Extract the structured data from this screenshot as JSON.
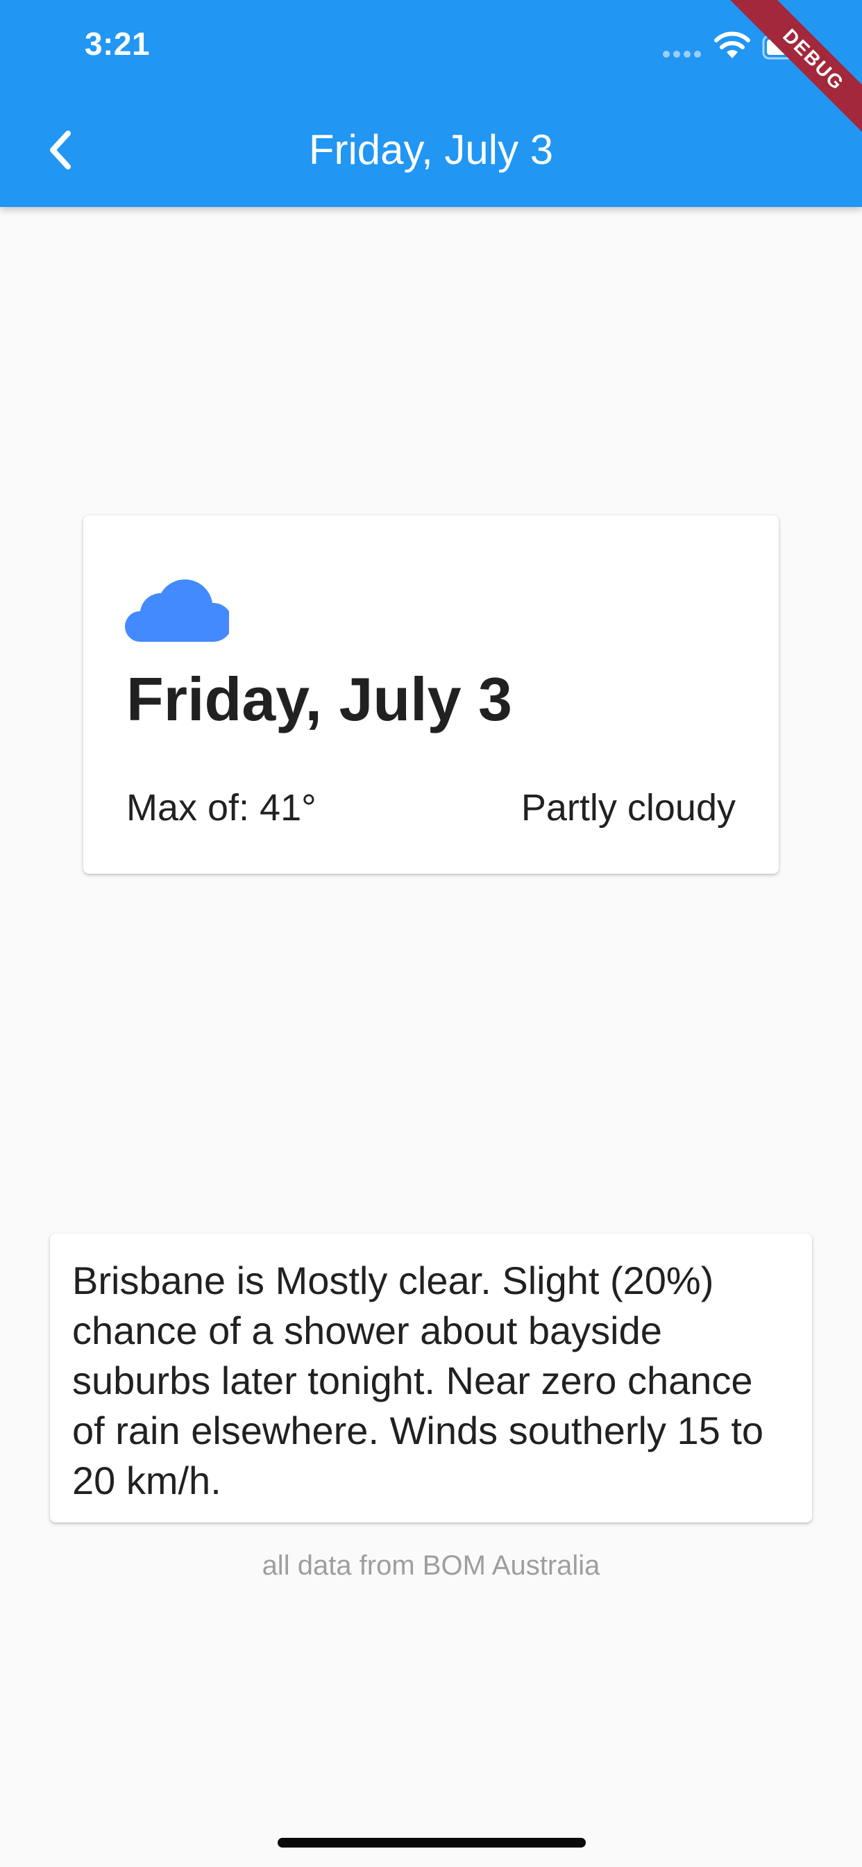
{
  "status_bar": {
    "time": "3:21"
  },
  "app_bar": {
    "title": "Friday, July 3",
    "back_icon": "chevron-left-icon",
    "background_color": "#2196f3",
    "debug_banner": "DEBUG",
    "debug_banner_color": "#a3283c"
  },
  "summary_card": {
    "weather_icon": "cloud-icon",
    "icon_color": "#448aff",
    "date": "Friday, July 3",
    "max_temp": "Max of: 41°",
    "condition": "Partly cloudy"
  },
  "forecast": {
    "text": "Brisbane is Mostly clear. Slight (20%) chance of a shower about bayside suburbs later tonight. Near zero chance of rain elsewhere. Winds southerly 15 to 20 km/h."
  },
  "footer": {
    "source_note": "all data from BOM Australia"
  }
}
